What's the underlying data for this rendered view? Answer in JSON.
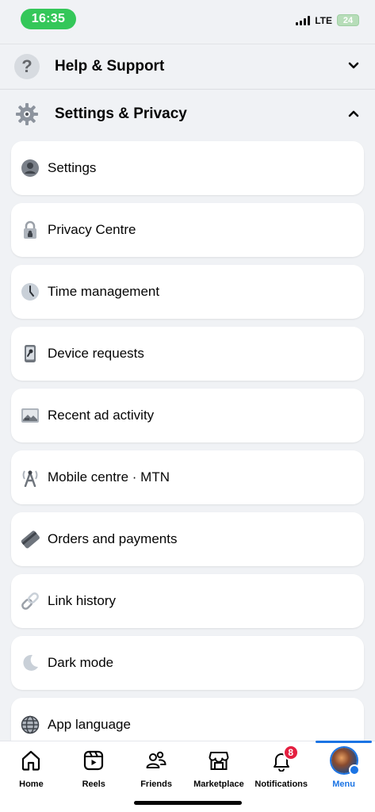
{
  "status_bar": {
    "time": "16:35",
    "network": "LTE",
    "battery": "24"
  },
  "sections": {
    "help": {
      "title": "Help & Support",
      "icon": "question-icon",
      "chevron": "⌄"
    },
    "settings": {
      "title": "Settings & Privacy",
      "icon": "gear-icon",
      "chevron": "⌃"
    }
  },
  "items": [
    {
      "label": "Settings",
      "icon": "user-circle-icon"
    },
    {
      "label": "Privacy Centre",
      "icon": "lock-icon"
    },
    {
      "label": "Time management",
      "icon": "clock-icon"
    },
    {
      "label": "Device requests",
      "icon": "phone-key-icon"
    },
    {
      "label": "Recent ad activity",
      "icon": "ad-image-icon"
    },
    {
      "label": "Mobile centre · MTN",
      "icon": "antenna-icon"
    },
    {
      "label": "Orders and payments",
      "icon": "card-icon"
    },
    {
      "label": "Link history",
      "icon": "link-icon"
    },
    {
      "label": "Dark mode",
      "icon": "moon-icon"
    },
    {
      "label": "App language",
      "icon": "globe-icon"
    }
  ],
  "tabs": [
    {
      "label": "Home",
      "icon": "home-icon"
    },
    {
      "label": "Reels",
      "icon": "reels-icon"
    },
    {
      "label": "Friends",
      "icon": "friends-icon"
    },
    {
      "label": "Marketplace",
      "icon": "marketplace-icon"
    },
    {
      "label": "Notifications",
      "icon": "bell-icon",
      "badge": "8"
    },
    {
      "label": "Menu",
      "icon": "profile-avatar",
      "active": true
    }
  ],
  "colors": {
    "accent": "#1b74e4",
    "badge": "#e41e3f",
    "time_pill": "#34c759",
    "background": "#f0f2f5"
  }
}
